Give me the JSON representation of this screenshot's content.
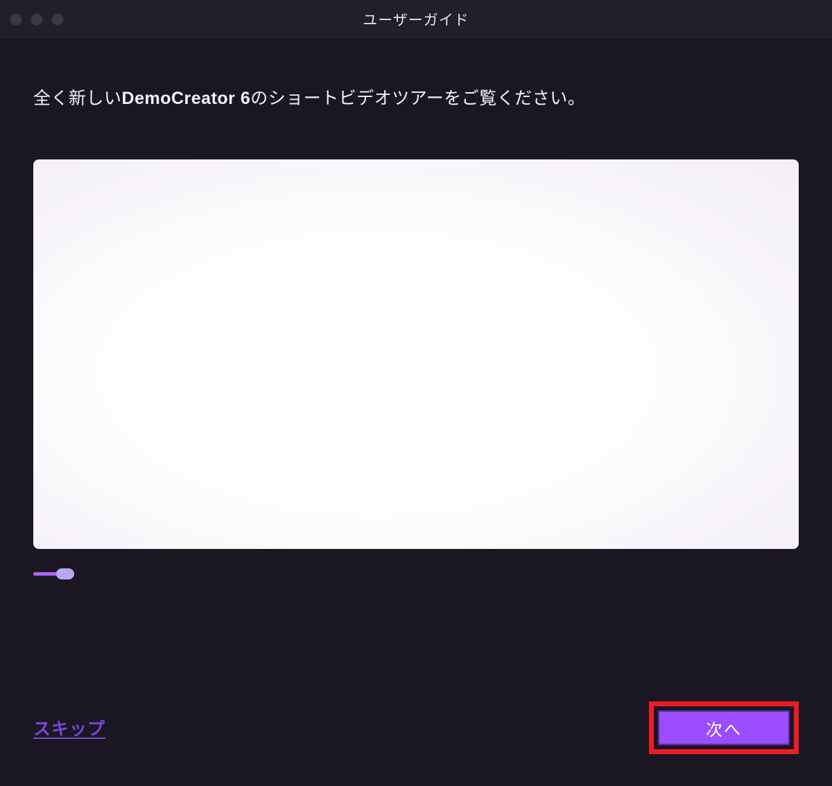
{
  "titlebar": {
    "title": "ユーザーガイド"
  },
  "headline": {
    "pre": "全く新しい",
    "bold": "DemoCreator 6",
    "post": "のショートビデオツアーをご覧ください。"
  },
  "footer": {
    "skip_label": "スキップ",
    "next_label": "次へ"
  }
}
